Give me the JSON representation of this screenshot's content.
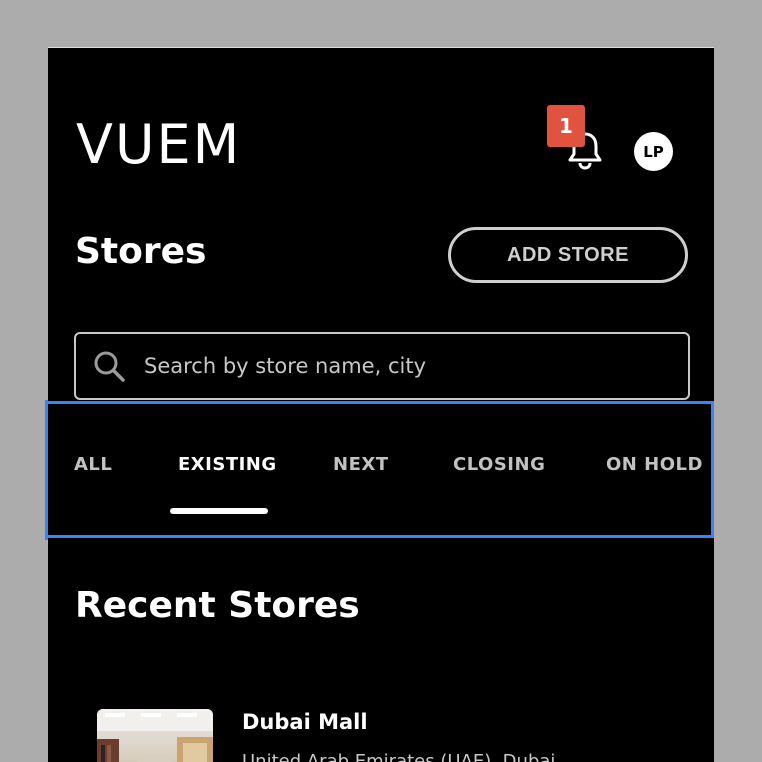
{
  "header": {
    "logo": "VUEM",
    "notification_count": "1",
    "avatar_initials": "LP"
  },
  "stores_section": {
    "title": "Stores",
    "add_store_label": "ADD STORE"
  },
  "search": {
    "placeholder": "Search by store name, city",
    "value": ""
  },
  "tabs": [
    {
      "label": "ALL",
      "active": false
    },
    {
      "label": "EXISTING",
      "active": true
    },
    {
      "label": "NEXT",
      "active": false
    },
    {
      "label": "CLOSING",
      "active": false
    },
    {
      "label": "ON HOLD",
      "active": false
    }
  ],
  "recent": {
    "title": "Recent Stores",
    "items": [
      {
        "name": "Dubai Mall",
        "location": "United Arab Emirates (UAE), Dubai"
      }
    ]
  },
  "colors": {
    "background": "#000000",
    "badge": "#e0533f",
    "highlight": "#3b82f6"
  },
  "icons": [
    "bell-icon",
    "search-icon",
    "more-icon"
  ]
}
